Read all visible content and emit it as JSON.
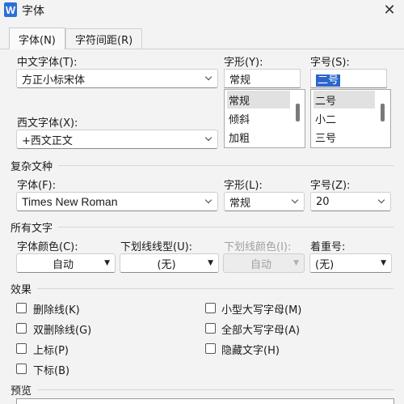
{
  "window": {
    "title": "字体",
    "app_icon_letter": "W",
    "close_glyph": "✕"
  },
  "tabs": [
    {
      "label": "字体(N)",
      "active": true
    },
    {
      "label": "字符间距(R)",
      "active": false
    }
  ],
  "cjk_font": {
    "label": "中文字体(T):",
    "value": "方正小标宋体"
  },
  "latin_font": {
    "label": "西文字体(X):",
    "value": "+西文正文"
  },
  "style": {
    "label": "字形(Y):",
    "value": "常规",
    "options": [
      "常规",
      "倾斜",
      "加粗"
    ]
  },
  "size": {
    "label": "字号(S):",
    "value": "二号",
    "options": [
      "二号",
      "小二",
      "三号"
    ]
  },
  "complex": {
    "section": "复杂文种",
    "font_label": "字体(F):",
    "font_value": "Times New Roman",
    "style_label": "字形(L):",
    "style_value": "常规",
    "size_label": "字号(Z):",
    "size_value": "20"
  },
  "all_text": {
    "section": "所有文字",
    "color_label": "字体颜色(C):",
    "color_value": "自动",
    "underline_label": "下划线线型(U):",
    "underline_value": "(无)",
    "underline_color_label": "下划线颜色(I):",
    "underline_color_value": "自动",
    "emphasis_label": "着重号:",
    "emphasis_value": "(无)"
  },
  "effects": {
    "section": "效果",
    "items": [
      "删除线(K)",
      "双删除线(G)",
      "上标(P)",
      "下标(B)",
      "小型大写字母(M)",
      "全部大写字母(A)",
      "隐藏文字(H)"
    ]
  },
  "preview": {
    "section": "预览"
  }
}
